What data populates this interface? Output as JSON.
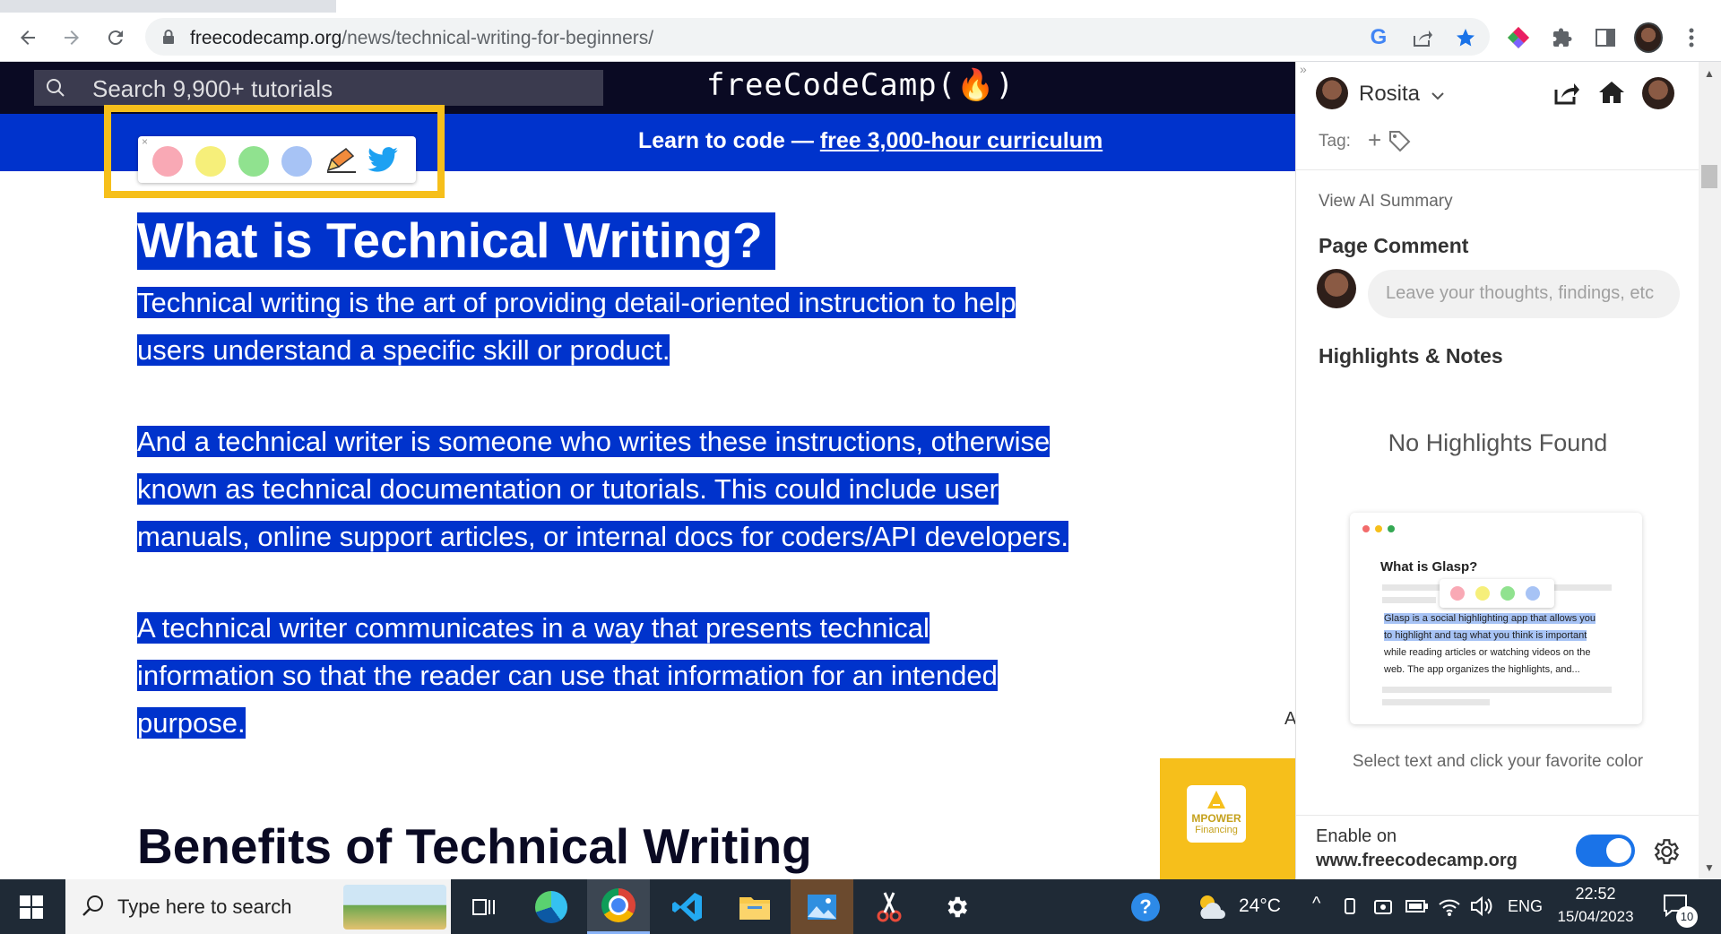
{
  "browser": {
    "url_host": "freecodecamp.org",
    "url_path": "/news/technical-writing-for-beginners/",
    "icons": [
      "back-icon",
      "forward-icon",
      "reload-icon",
      "lock-icon",
      "google-icon",
      "share-icon",
      "bookmark-star-icon",
      "glasp-extension-icon",
      "extensions-puzzle-icon",
      "side-panel-icon",
      "profile-avatar",
      "more-menu-icon"
    ]
  },
  "site": {
    "search_placeholder": "Search 9,900+ tutorials",
    "logo": "freeCodeCamp(🔥)",
    "banner_prefix": "Learn to code — ",
    "banner_link": "free 3,000-hour curriculum"
  },
  "highlight_popup": {
    "colors": [
      "#f9a9b5",
      "#f6ef7a",
      "#90e28f",
      "#a7c3f5"
    ],
    "close": "×"
  },
  "article": {
    "title": "What is Technical Writing?",
    "p1_l1": "Technical writing is the art of providing detail-oriented instruction to help",
    "p1_l2": "users understand a specific skill or product.",
    "p2_l1": "And a technical writer is someone who writes these instructions, otherwise",
    "p2_l2": "known as technical documentation or tutorials. This could include user",
    "p2_l3": "manuals, online support articles, or internal docs for coders/API developers.",
    "p3_l1": "A technical writer communicates in a way that presents technical",
    "p3_l2": "information so that the reader can use that information for an intended",
    "p3_l3": "purpose.",
    "h2": "Benefits of Technical Writing",
    "ad_label": "A",
    "ad_brand": "MPOWER",
    "ad_sub": "Financing"
  },
  "glasp": {
    "user_name": "Rosita",
    "tag_label": "Tag:",
    "tag_add": "+",
    "view_ai_summary": "View AI Summary",
    "page_comment_heading": "Page Comment",
    "comment_placeholder": "Leave your thoughts, findings, etc",
    "highlights_heading": "Highlights & Notes",
    "empty_state": "No Highlights Found",
    "demo_title": "What is Glasp?",
    "demo_hl1": "Glasp is a social highlighting app that allows you",
    "demo_hl2": "to highlight and tag what you think is important",
    "demo_t3": "while reading articles or watching videos on the",
    "demo_t4": "web. The app organizes the highlights, and...",
    "instruction": "Select text and click your favorite color",
    "enable_on": "Enable on",
    "site": "www.freecodecamp.org",
    "enabled": true
  },
  "taskbar": {
    "search_placeholder": "Type here to search",
    "temperature": "24°C",
    "language": "ENG",
    "time": "22:52",
    "date": "15/04/2023",
    "notification_count": "10"
  }
}
